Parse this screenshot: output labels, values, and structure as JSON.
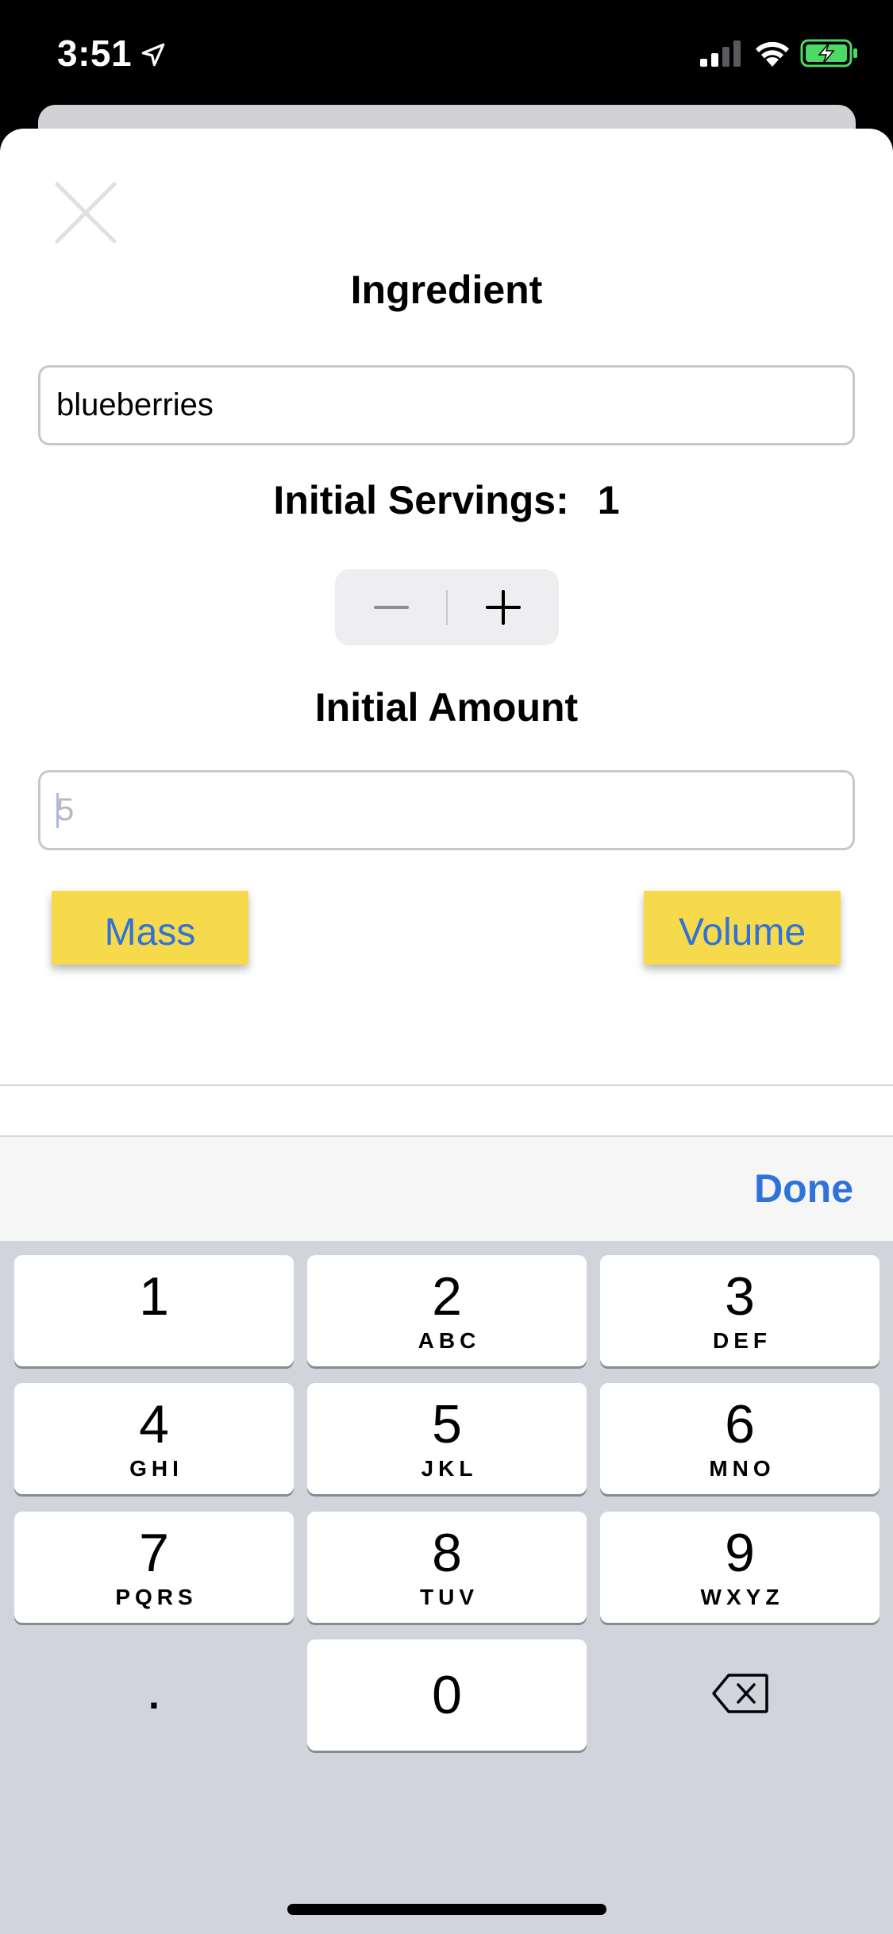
{
  "status_bar": {
    "time": "3:51",
    "location_icon": "location-arrow-icon",
    "signal_icon": "cellular-signal-icon",
    "wifi_icon": "wifi-icon",
    "battery_icon": "battery-charging-icon",
    "battery_color": "#4cd964"
  },
  "sheet": {
    "close_icon": "close-icon",
    "ingredient_title": "Ingredient",
    "ingredient_value": "blueberries",
    "servings_label": "Initial Servings:",
    "servings_value": "1",
    "stepper": {
      "decrement_icon": "minus-icon",
      "increment_icon": "plus-icon"
    },
    "amount_title": "Initial Amount",
    "amount_placeholder": "5",
    "mass_label": "Mass",
    "volume_label": "Volume",
    "button_color": "#f7d94c",
    "accent_color": "#2f72d9"
  },
  "keyboard": {
    "done_label": "Done",
    "keys": [
      {
        "digit": "1",
        "letters": ""
      },
      {
        "digit": "2",
        "letters": "ABC"
      },
      {
        "digit": "3",
        "letters": "DEF"
      },
      {
        "digit": "4",
        "letters": "GHI"
      },
      {
        "digit": "5",
        "letters": "JKL"
      },
      {
        "digit": "6",
        "letters": "MNO"
      },
      {
        "digit": "7",
        "letters": "PQRS"
      },
      {
        "digit": "8",
        "letters": "TUV"
      },
      {
        "digit": "9",
        "letters": "WXYZ"
      }
    ],
    "decimal_label": ".",
    "zero_label": "0",
    "delete_icon": "backspace-icon"
  }
}
